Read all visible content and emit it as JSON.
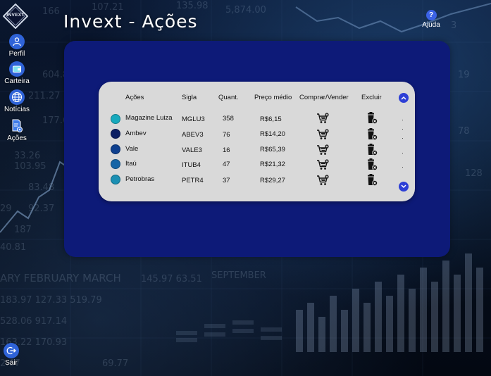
{
  "app": {
    "logo_text": "INVEXT",
    "title": "Invext - Ações"
  },
  "sidebar": {
    "items": [
      {
        "label": "Perfil",
        "icon": "user-icon"
      },
      {
        "label": "Carteira",
        "icon": "wallet-icon"
      },
      {
        "label": "Notícias",
        "icon": "globe-icon"
      },
      {
        "label": "Ações",
        "icon": "document-chart-icon"
      }
    ],
    "logout": {
      "label": "Sair",
      "icon": "logout-icon"
    }
  },
  "help": {
    "label": "Ajuda",
    "icon_text": "?"
  },
  "table": {
    "headers": {
      "acoes": "Ações",
      "sigla": "Sigla",
      "quant": "Quant.",
      "preco": "Preço médio",
      "comprar": "Comprar/Vender",
      "excluir": "Excluir"
    },
    "rows": [
      {
        "name": "Magazine Luiza",
        "ticker": "MGLU3",
        "qty": "358",
        "price": "R$6,15",
        "color": "#17a9bd"
      },
      {
        "name": "Ambev",
        "ticker": "ABEV3",
        "qty": "76",
        "price": "R$14,20",
        "color": "#0c1f63"
      },
      {
        "name": "Vale",
        "ticker": "VALE3",
        "qty": "16",
        "price": "R$65,39",
        "color": "#0e3f8e"
      },
      {
        "name": "Itaú",
        "ticker": "ITUB4",
        "qty": "47",
        "price": "R$21,32",
        "color": "#1565a6"
      },
      {
        "name": "Petrobras",
        "ticker": "PETR4",
        "qty": "37",
        "price": "R$29,27",
        "color": "#1a8fb3"
      }
    ]
  },
  "colors": {
    "panel": "#0d1a78",
    "card": "#d9d9d9",
    "accent": "#2d3fd6"
  }
}
